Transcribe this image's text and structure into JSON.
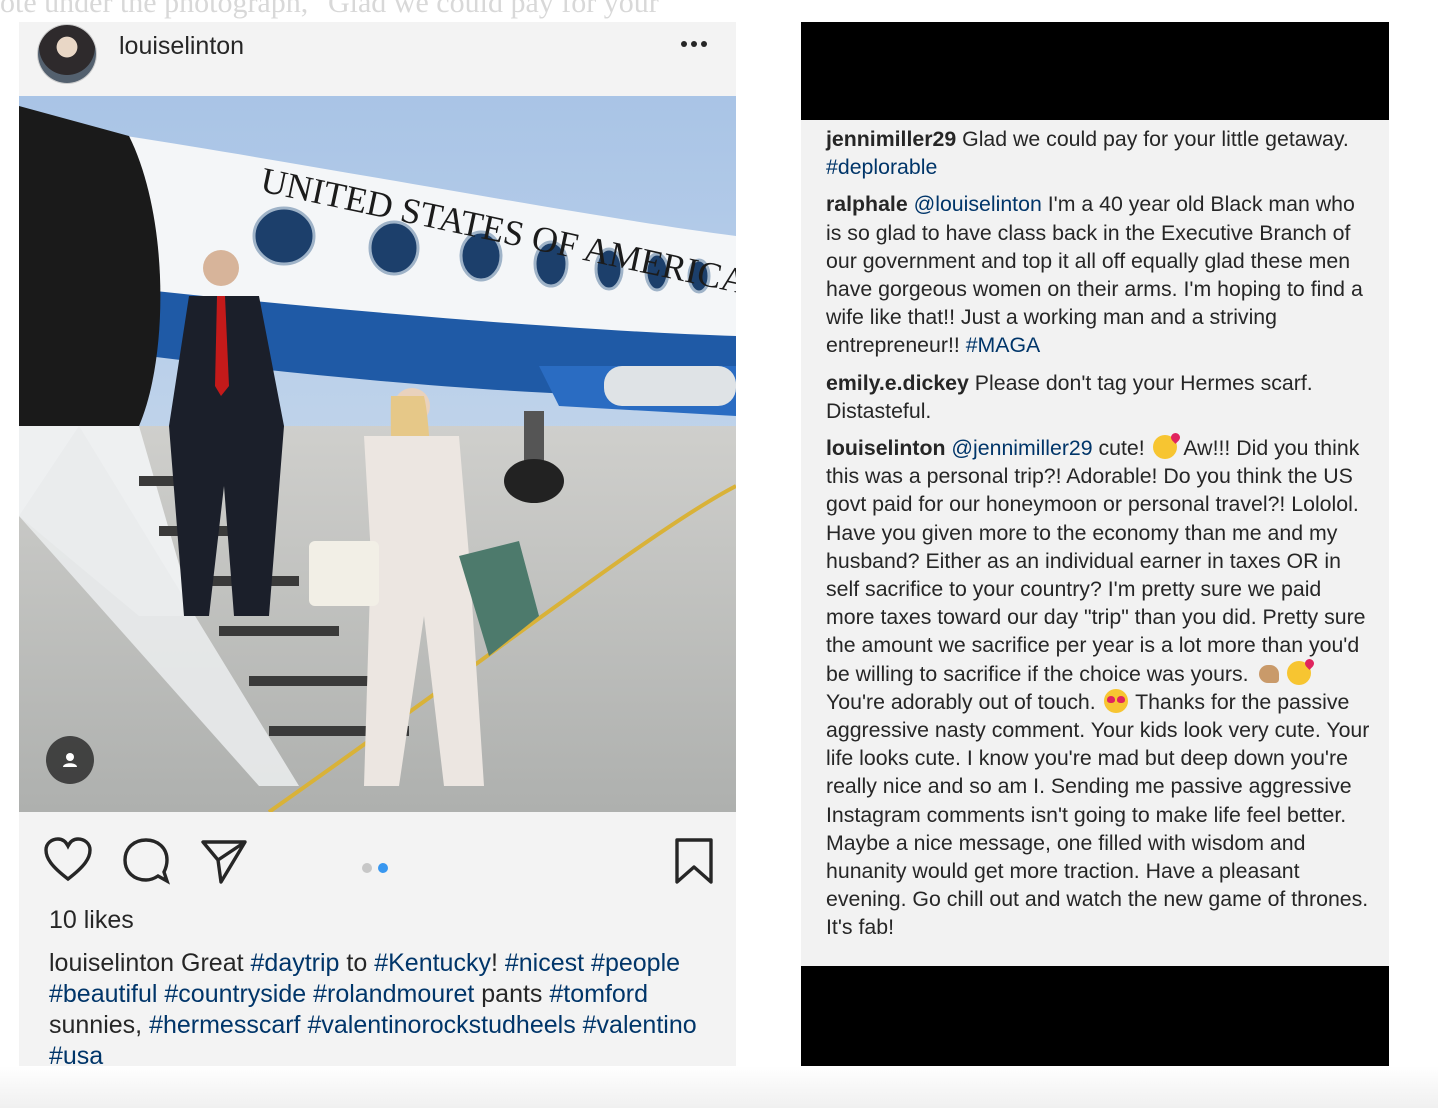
{
  "background_caption": "ote under the photograph, \"Glad we could pay for your",
  "post": {
    "username": "louiselinton",
    "likes": "10 likes",
    "image": {
      "aircraft_lettering": "UNITED STATES OF AMERICA"
    },
    "caption": {
      "user": "louiselinton",
      "parts": [
        {
          "t": " Great ",
          "tag": false
        },
        {
          "t": "#daytrip",
          "tag": true
        },
        {
          "t": " to ",
          "tag": false
        },
        {
          "t": "#Kentucky",
          "tag": true
        },
        {
          "t": "! ",
          "tag": false
        },
        {
          "t": "#nicest",
          "tag": true
        },
        {
          "t": " ",
          "tag": false
        },
        {
          "t": "#people",
          "tag": true
        },
        {
          "t": " ",
          "tag": false
        },
        {
          "t": "#beautiful",
          "tag": true
        },
        {
          "t": " ",
          "tag": false
        },
        {
          "t": "#countryside",
          "tag": true
        },
        {
          "t": " ",
          "tag": false
        },
        {
          "t": "#rolandmouret",
          "tag": true
        },
        {
          "t": " pants ",
          "tag": false
        },
        {
          "t": "#tomford",
          "tag": true
        },
        {
          "t": " sunnies, ",
          "tag": false
        },
        {
          "t": "#hermesscarf",
          "tag": true
        },
        {
          "t": " ",
          "tag": false
        },
        {
          "t": "#valentinorockstudheels",
          "tag": true
        },
        {
          "t": " ",
          "tag": false
        },
        {
          "t": "#valentino",
          "tag": true
        },
        {
          "t": " ",
          "tag": false
        },
        {
          "t": "#usa",
          "tag": true
        }
      ]
    },
    "icons": {
      "more": "more-options-icon",
      "like": "heart-icon",
      "comment": "comment-icon",
      "share": "send-icon",
      "save": "bookmark-icon",
      "tag": "person-icon"
    },
    "carousel": {
      "count": 2,
      "active": 2
    },
    "colors": {
      "hashtag": "#003569",
      "active_dot": "#3897f0"
    }
  },
  "comments": [
    {
      "user": "jennimiller29",
      "parts": [
        {
          "t": " Glad we could pay for your little getaway. ",
          "kind": "text"
        },
        {
          "t": "#deplorable",
          "kind": "tag"
        }
      ]
    },
    {
      "user": "ralphale",
      "parts": [
        {
          "t": " ",
          "kind": "text"
        },
        {
          "t": "@louiselinton",
          "kind": "tag"
        },
        {
          "t": " I'm a 40 year old Black man who is so glad to have class back in the Executive Branch of our government and top it all off equally glad these men have gorgeous women on their arms. I'm hoping to find a wife like that!! Just a working man and a striving entrepreneur!! ",
          "kind": "text"
        },
        {
          "t": "#MAGA",
          "kind": "tag"
        }
      ]
    },
    {
      "user": "emily.e.dickey",
      "parts": [
        {
          "t": " Please don't tag your Hermes scarf. Distasteful.",
          "kind": "text"
        }
      ]
    },
    {
      "user": "louiselinton",
      "parts": [
        {
          "t": " ",
          "kind": "text"
        },
        {
          "t": "@jennimiller29",
          "kind": "tag"
        },
        {
          "t": " cute! ",
          "kind": "text"
        },
        {
          "t": "kiss",
          "kind": "emoji"
        },
        {
          "t": " Aw!!! Did you think this was a personal trip?! Adorable! Do you think the US govt paid for our honeymoon or personal travel?! Lololol. Have you given more to the economy than me and my husband? Either as an individual earner in taxes OR in self sacrifice to your country? I'm pretty sure we paid more taxes toward our day \"trip\" than you did. Pretty sure the amount we sacrifice per year is a lot more than you'd be willing to sacrifice if the choice was yours. ",
          "kind": "text"
        },
        {
          "t": "arm",
          "kind": "emoji"
        },
        {
          "t": "kiss",
          "kind": "emoji"
        },
        {
          "t": " You're adorably out of touch. ",
          "kind": "text"
        },
        {
          "t": "love",
          "kind": "emoji"
        },
        {
          "t": " Thanks for the passive aggressive nasty comment. Your kids look very cute. Your life looks cute. I know you're mad but deep down you're really nice and so am I. Sending me passive aggressive Instagram comments isn't going to make life feel better. Maybe a nice message, one filled with wisdom and hunanity would get more traction. Have a pleasant evening. Go chill out and watch the new game of thrones. It's fab!",
          "kind": "text"
        }
      ]
    }
  ]
}
